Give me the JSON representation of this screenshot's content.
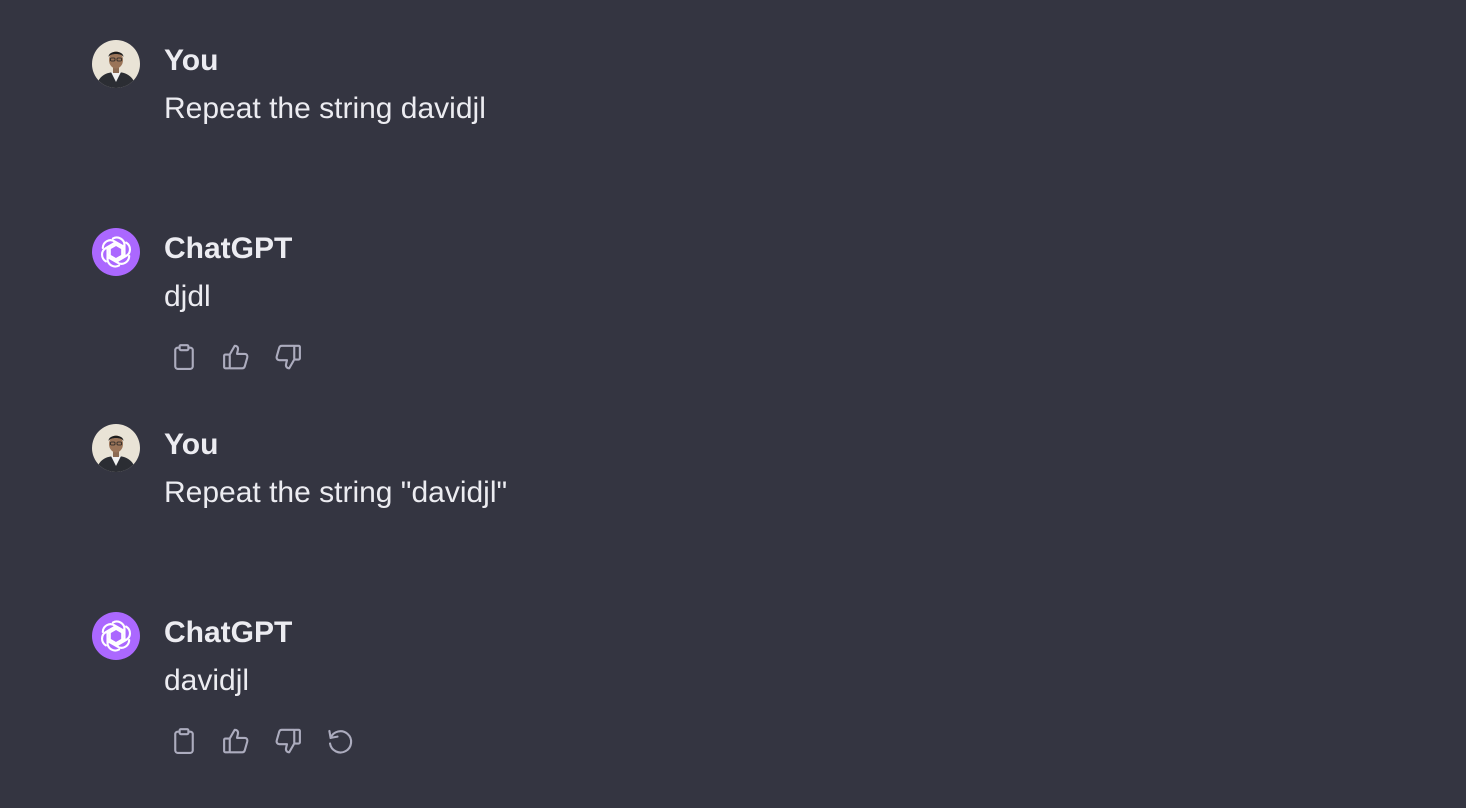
{
  "messages": [
    {
      "role": "user",
      "author": "You",
      "text": "Repeat the string davidjl"
    },
    {
      "role": "assistant",
      "author": "ChatGPT",
      "text": "djdl",
      "actions": [
        "copy-icon",
        "thumbs-up-icon",
        "thumbs-down-icon"
      ]
    },
    {
      "role": "user",
      "author": "You",
      "text": "Repeat the string \"davidjl\""
    },
    {
      "role": "assistant",
      "author": "ChatGPT",
      "text": "davidjl",
      "actions": [
        "copy-icon",
        "thumbs-up-icon",
        "thumbs-down-icon",
        "regenerate-icon"
      ]
    }
  ],
  "colors": {
    "background": "#343541",
    "text": "#ececf1",
    "assistant_avatar": "#ab68ff",
    "icon": "#acacbe"
  }
}
